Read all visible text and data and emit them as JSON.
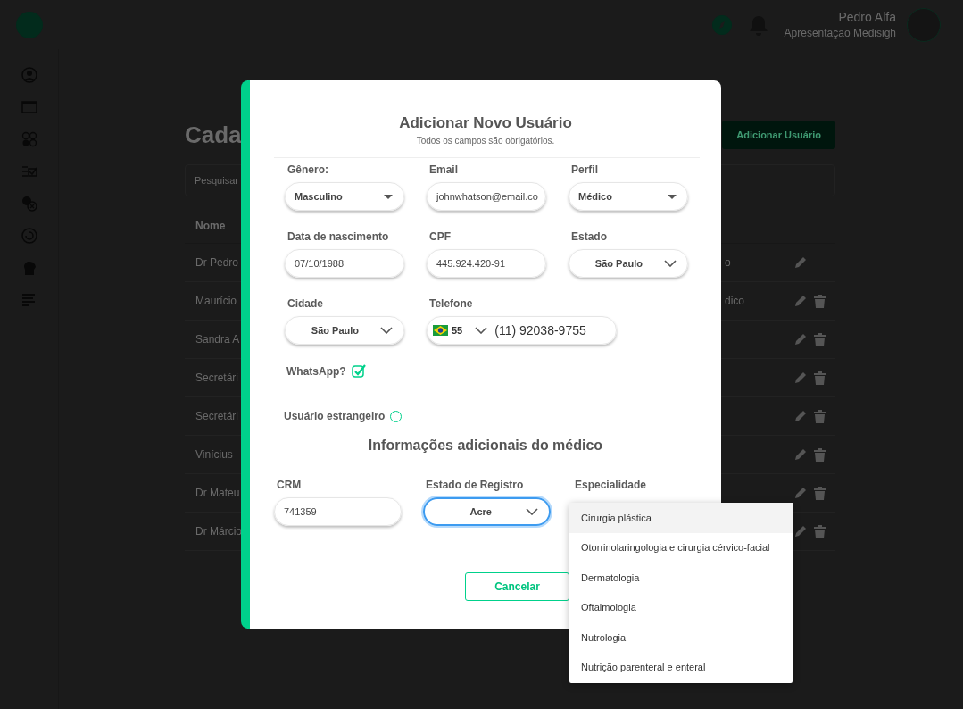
{
  "header": {
    "user_name": "Pedro Alfa",
    "user_subtitle": "Apresentação Medisigh"
  },
  "page": {
    "title": "Cada",
    "add_button": "Adicionar Usuário",
    "search_placeholder": "Pesquisar",
    "column": "Nome",
    "rows": [
      {
        "name": "Dr Pedro",
        "role": "o",
        "deletable": false
      },
      {
        "name": "Maurício",
        "role": "dico",
        "deletable": true
      },
      {
        "name": "Sandra A",
        "deletable": true
      },
      {
        "name": "Secretári",
        "deletable": true
      },
      {
        "name": "Secretári",
        "deletable": true
      },
      {
        "name": "Vinícius",
        "deletable": true
      },
      {
        "name": "Dr Mateu",
        "deletable": true
      },
      {
        "name": "Dr Márcio",
        "deletable": true
      }
    ]
  },
  "modal": {
    "title": "Adicionar Novo Usuário",
    "subtitle": "Todos os campos são obrigatórios.",
    "fields": [
      {
        "label": "Gênero:",
        "kind": "select",
        "value": "Masculino"
      },
      {
        "label": "Email",
        "kind": "input",
        "value": "johnwhatson@email.co"
      },
      {
        "label": "Perfil",
        "kind": "select",
        "value": "Médico"
      },
      {
        "label": "Data de nascimento",
        "kind": "input",
        "value": "07/10/1988"
      },
      {
        "label": "CPF",
        "kind": "input",
        "value": "445.924.420-91"
      },
      {
        "label": "Estado",
        "kind": "centered-select",
        "value": "São Paulo"
      },
      {
        "label": "Cidade",
        "kind": "centered-select",
        "value": "São Paulo"
      },
      {
        "label": "Telefone",
        "kind": "phone",
        "code": "55",
        "value": "(11) 92038-9755"
      }
    ],
    "whatsapp": {
      "label": "WhatsApp?",
      "checked": true
    },
    "foreign": {
      "label": "Usuário estrangeiro",
      "checked": false
    },
    "section_title": "Informações adicionais do médico",
    "doctor_fields": [
      {
        "label": "CRM",
        "kind": "input",
        "value": "741359",
        "focused": false
      },
      {
        "label": "Estado de Registro",
        "kind": "centered-select",
        "value": "Acre",
        "focused": true
      },
      {
        "label": "Especialidade",
        "kind": "covered"
      }
    ],
    "cancel_button": "Cancelar"
  },
  "dropdown": {
    "options": [
      {
        "label": "Cirurgia plástica",
        "selected": true
      },
      {
        "label": "Otorrinolaringologia e cirurgia cérvico-facial",
        "selected": false
      },
      {
        "label": "Dermatologia",
        "selected": false
      },
      {
        "label": "Oftalmologia",
        "selected": false
      },
      {
        "label": "Nutrologia",
        "selected": false
      },
      {
        "label": "Nutrição parenteral e enteral",
        "selected": false
      }
    ]
  }
}
